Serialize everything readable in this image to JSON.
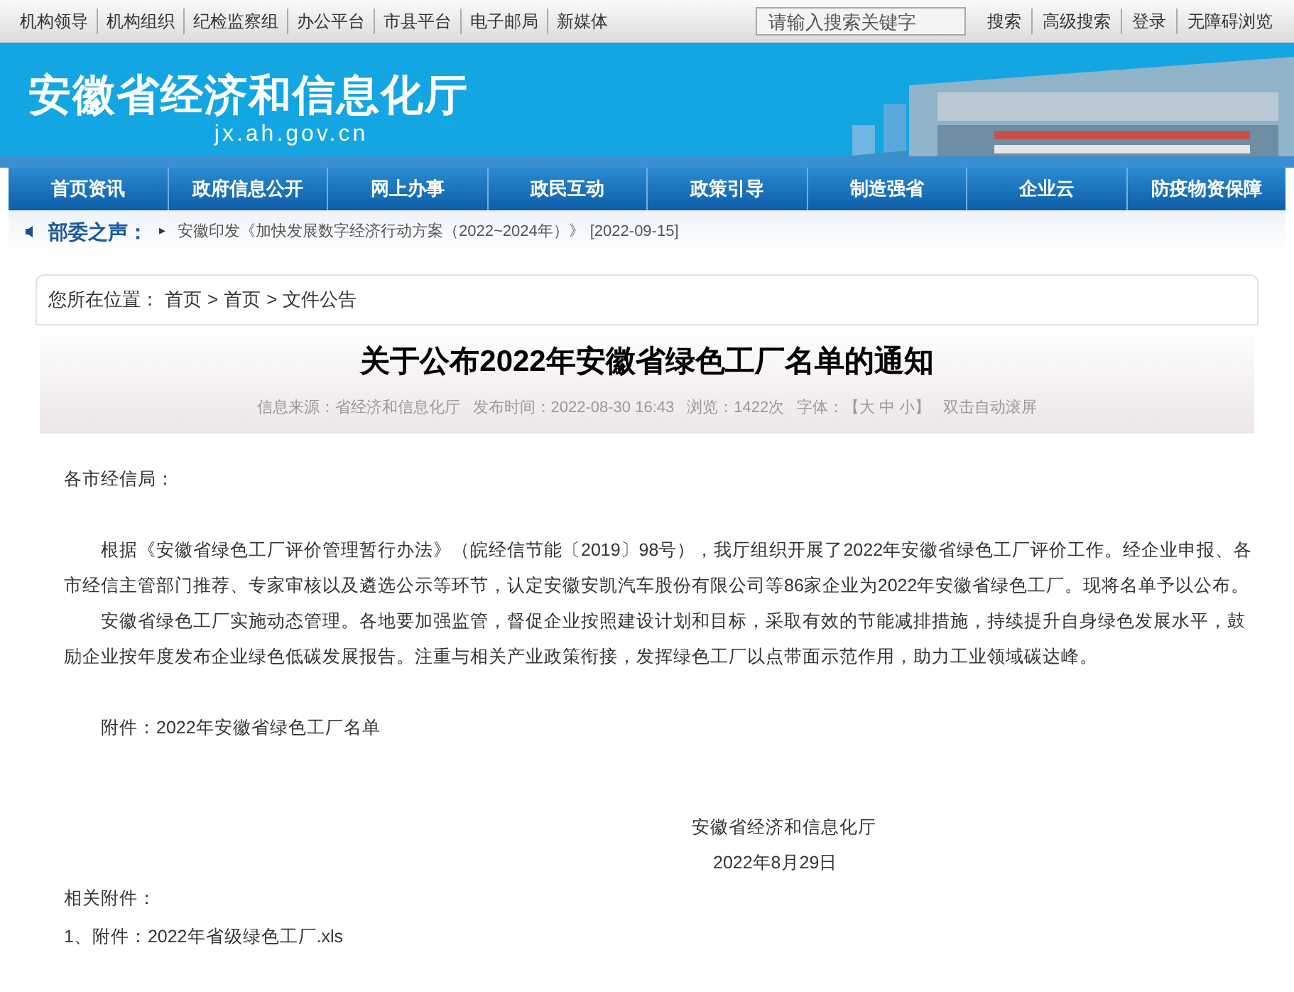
{
  "top_links": [
    "机构领导",
    "机构组织",
    "纪检监察组",
    "办公平台",
    "市县平台",
    "电子邮局",
    "新媒体"
  ],
  "search": {
    "placeholder": "请输入搜索关键字"
  },
  "top_actions": [
    "搜索",
    "高级搜索",
    "登录",
    "无障碍浏览"
  ],
  "site": {
    "title": "安徽省经济和信息化厅",
    "domain": "jx.ah.gov.cn"
  },
  "nav": [
    "首页资讯",
    "政府信息公开",
    "网上办事",
    "政民互动",
    "政策引导",
    "制造强省",
    "企业云",
    "防疫物资保障"
  ],
  "notice": {
    "label": "部委之声：",
    "bullet": "▸",
    "text": "安徽印发《加快发展数字经济行动方案（2022~2024年）》",
    "date": "[2022-09-15]"
  },
  "breadcrumb": {
    "prefix": "您所在位置：",
    "separator": ">",
    "items": [
      "首页",
      "首页",
      "文件公告"
    ]
  },
  "article": {
    "title": "关于公布2022年安徽省绿色工厂名单的通知",
    "meta": [
      "信息来源：省经济和信息化厅",
      "发布时间：2022-08-30 16:43",
      "浏览：1422次",
      "字体：【大 中 小】",
      "双击自动滚屏"
    ],
    "greeting": "各市经信局：",
    "paragraphs": [
      "根据《安徽省绿色工厂评价管理暂行办法》（皖经信节能〔2019〕98号），我厅组织开展了2022年安徽省绿色工厂评价工作。经企业申报、各市经信主管部门推荐、专家审核以及遴选公示等环节，认定安徽安凯汽车股份有限公司等86家企业为2022年安徽省绿色工厂。现将名单予以公布。",
      "安徽省绿色工厂实施动态管理。各地要加强监管，督促企业按照建设计划和目标，采取有效的节能减排措施，持续提升自身绿色发展水平，鼓励企业按年度发布企业绿色低碳发展报告。注重与相关产业政策衔接，发挥绿色工厂以点带面示范作用，助力工业领域碳达峰。"
    ],
    "attachment_note": "附件：2022年安徽省绿色工厂名单",
    "signature": "安徽省经济和信息化厅",
    "date": "2022年8月29日",
    "related_label": "相关附件：",
    "attachments": [
      "1、附件：2022年省级绿色工厂.xls"
    ]
  }
}
